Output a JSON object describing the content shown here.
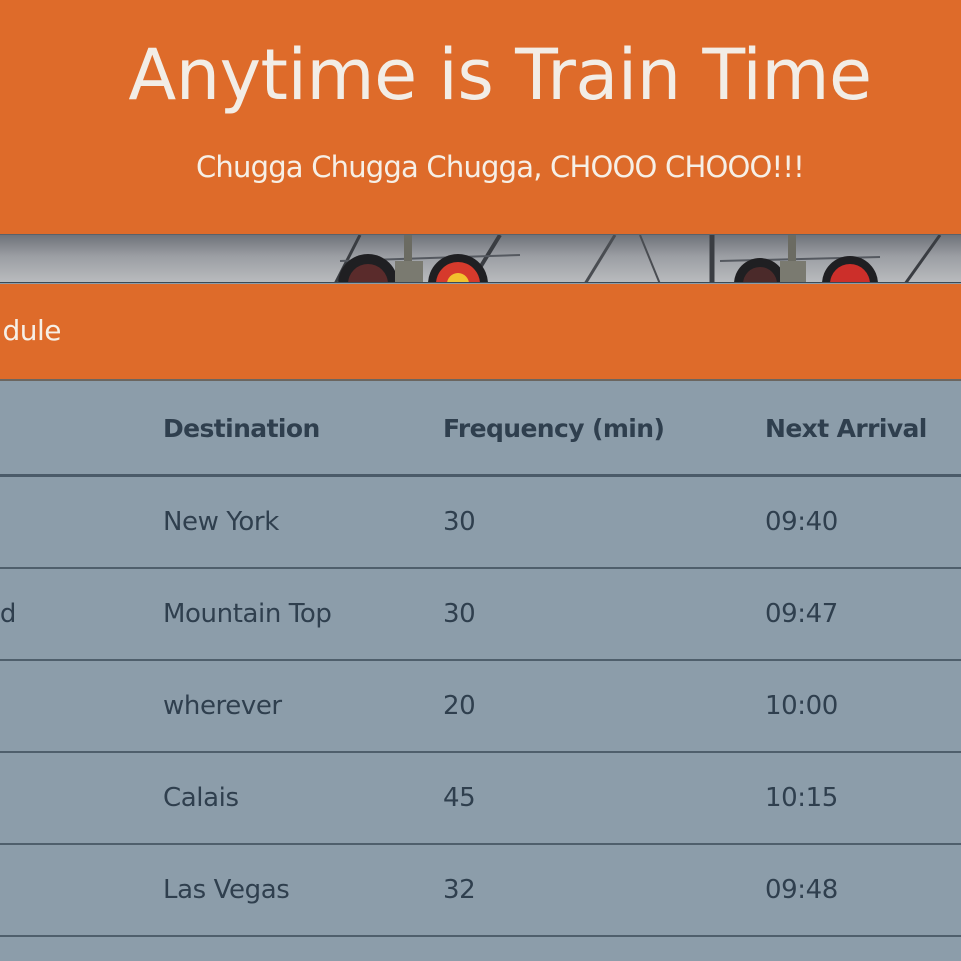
{
  "header": {
    "title": "Anytime is Train Time",
    "subtitle": "Chugga Chugga Chugga, CHOOO CHOOO!!!"
  },
  "panel": {
    "title_partial": "dule"
  },
  "table": {
    "columns": [
      "",
      "Destination",
      "Frequency (min)",
      "Next Arrival"
    ],
    "rows": [
      {
        "name": "",
        "destination": "New York",
        "frequency": "30",
        "next_arrival": "09:40"
      },
      {
        "name": "d",
        "destination": "Mountain Top",
        "frequency": "30",
        "next_arrival": "09:47"
      },
      {
        "name": "",
        "destination": "wherever",
        "frequency": "20",
        "next_arrival": "10:00"
      },
      {
        "name": "",
        "destination": "Calais",
        "frequency": "45",
        "next_arrival": "10:15"
      },
      {
        "name": "",
        "destination": "Las Vegas",
        "frequency": "32",
        "next_arrival": "09:48"
      }
    ]
  },
  "colors": {
    "accent": "#de6b2a",
    "table_bg": "#8c9daa",
    "text": "#2f3f4e"
  }
}
